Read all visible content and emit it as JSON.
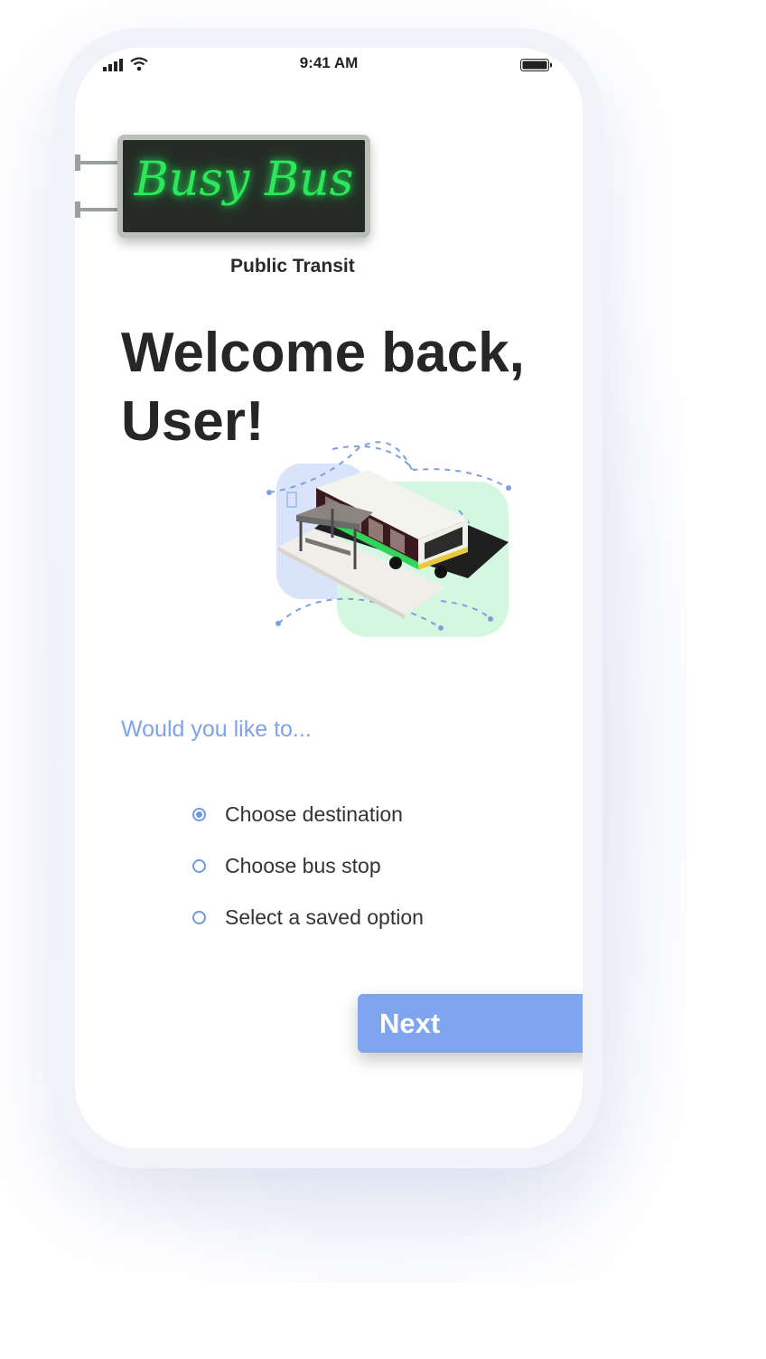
{
  "status_bar": {
    "time": "9:41 AM"
  },
  "brand": {
    "name": "Busy Bus",
    "subtitle": "Public Transit"
  },
  "welcome": {
    "line1": "Welcome back,",
    "line2": "User!"
  },
  "prompt": "Would you like to...",
  "options": [
    {
      "label": "Choose destination",
      "selected": true
    },
    {
      "label": "Choose bus stop",
      "selected": false
    },
    {
      "label": "Select a saved option",
      "selected": false
    }
  ],
  "next_label": "Next",
  "colors": {
    "accent": "#7ea5ed",
    "neon_green": "#2ee65a",
    "title": "#262626",
    "tile_blue": "#d9e4fb",
    "tile_green": "#d4f7df"
  }
}
